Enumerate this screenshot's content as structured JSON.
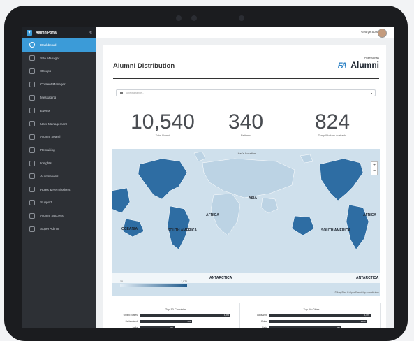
{
  "app": {
    "name": "AlumniPortal",
    "collapse_glyph": "«"
  },
  "user": {
    "name": "George Scott"
  },
  "sidebar": {
    "items": [
      {
        "label": "Dashboard",
        "icon": "dashboard-icon",
        "active": true
      },
      {
        "label": "Site Manager",
        "icon": "site-manager-icon"
      },
      {
        "label": "Groups",
        "icon": "groups-icon"
      },
      {
        "label": "Content Manager",
        "icon": "content-manager-icon"
      },
      {
        "label": "Messaging",
        "icon": "messaging-icon"
      },
      {
        "label": "Events",
        "icon": "events-icon"
      },
      {
        "label": "User Management",
        "icon": "user-management-icon"
      },
      {
        "label": "Alumni Search",
        "icon": "alumni-search-icon"
      },
      {
        "label": "Recruiting",
        "icon": "recruiting-icon"
      },
      {
        "label": "Insights",
        "icon": "insights-icon"
      },
      {
        "label": "Automations",
        "icon": "automations-icon"
      },
      {
        "label": "Roles & Permissions",
        "icon": "roles-permissions-icon"
      },
      {
        "label": "Support",
        "icon": "support-icon"
      },
      {
        "label": "Alumni Success",
        "icon": "alumni-success-icon"
      },
      {
        "label": "Super Admin",
        "icon": "super-admin-icon"
      }
    ]
  },
  "page": {
    "title": "Alumni Distribution",
    "brand": {
      "mark": "FA",
      "name": "Alumni",
      "small": "Professionals"
    },
    "range_placeholder": "Select a range...",
    "stats": [
      {
        "value": "10,540",
        "label": "Total Alumni"
      },
      {
        "value": "340",
        "label": "Retirees"
      },
      {
        "value": "824",
        "label": "Temp Workers Available"
      }
    ]
  },
  "map": {
    "title": "User's Location",
    "zoom_in": "+",
    "zoom_out": "−",
    "legend_min": "10",
    "legend_max": "1,070",
    "attribution": "© MapTiler © OpenStreetMap contributors",
    "labels": [
      {
        "text": "AFRICA"
      },
      {
        "text": "ASIA"
      },
      {
        "text": "OCEANIA"
      },
      {
        "text": "SOUTH AMERICA"
      },
      {
        "text": "ANTARCTICA"
      },
      {
        "text": "ANTARCTICA"
      },
      {
        "text": "AFRICA"
      },
      {
        "text": "SOUTH AMERICA"
      }
    ],
    "colors": {
      "water": "#cfe0ec",
      "land_light": "#bcd3e4",
      "land_dark": "#2e6da3"
    }
  },
  "panels": {
    "countries": {
      "title": "Top 10 Countries",
      "rows": [
        {
          "label": "United States",
          "value": 1070,
          "value_label": "1,070"
        },
        {
          "label": "Switzerland",
          "value": 620,
          "value_label": "620"
        },
        {
          "label": "India",
          "value": 410,
          "value_label": "410"
        }
      ]
    },
    "cities": {
      "title": "Top 10 Cities",
      "rows": [
        {
          "label": "Lausanne",
          "value": 1070,
          "value_label": "1,070"
        },
        {
          "label": "Dubai",
          "value": 1030,
          "value_label": "1,030"
        },
        {
          "label": "Paris",
          "value": 760,
          "value_label": "760"
        }
      ]
    }
  }
}
